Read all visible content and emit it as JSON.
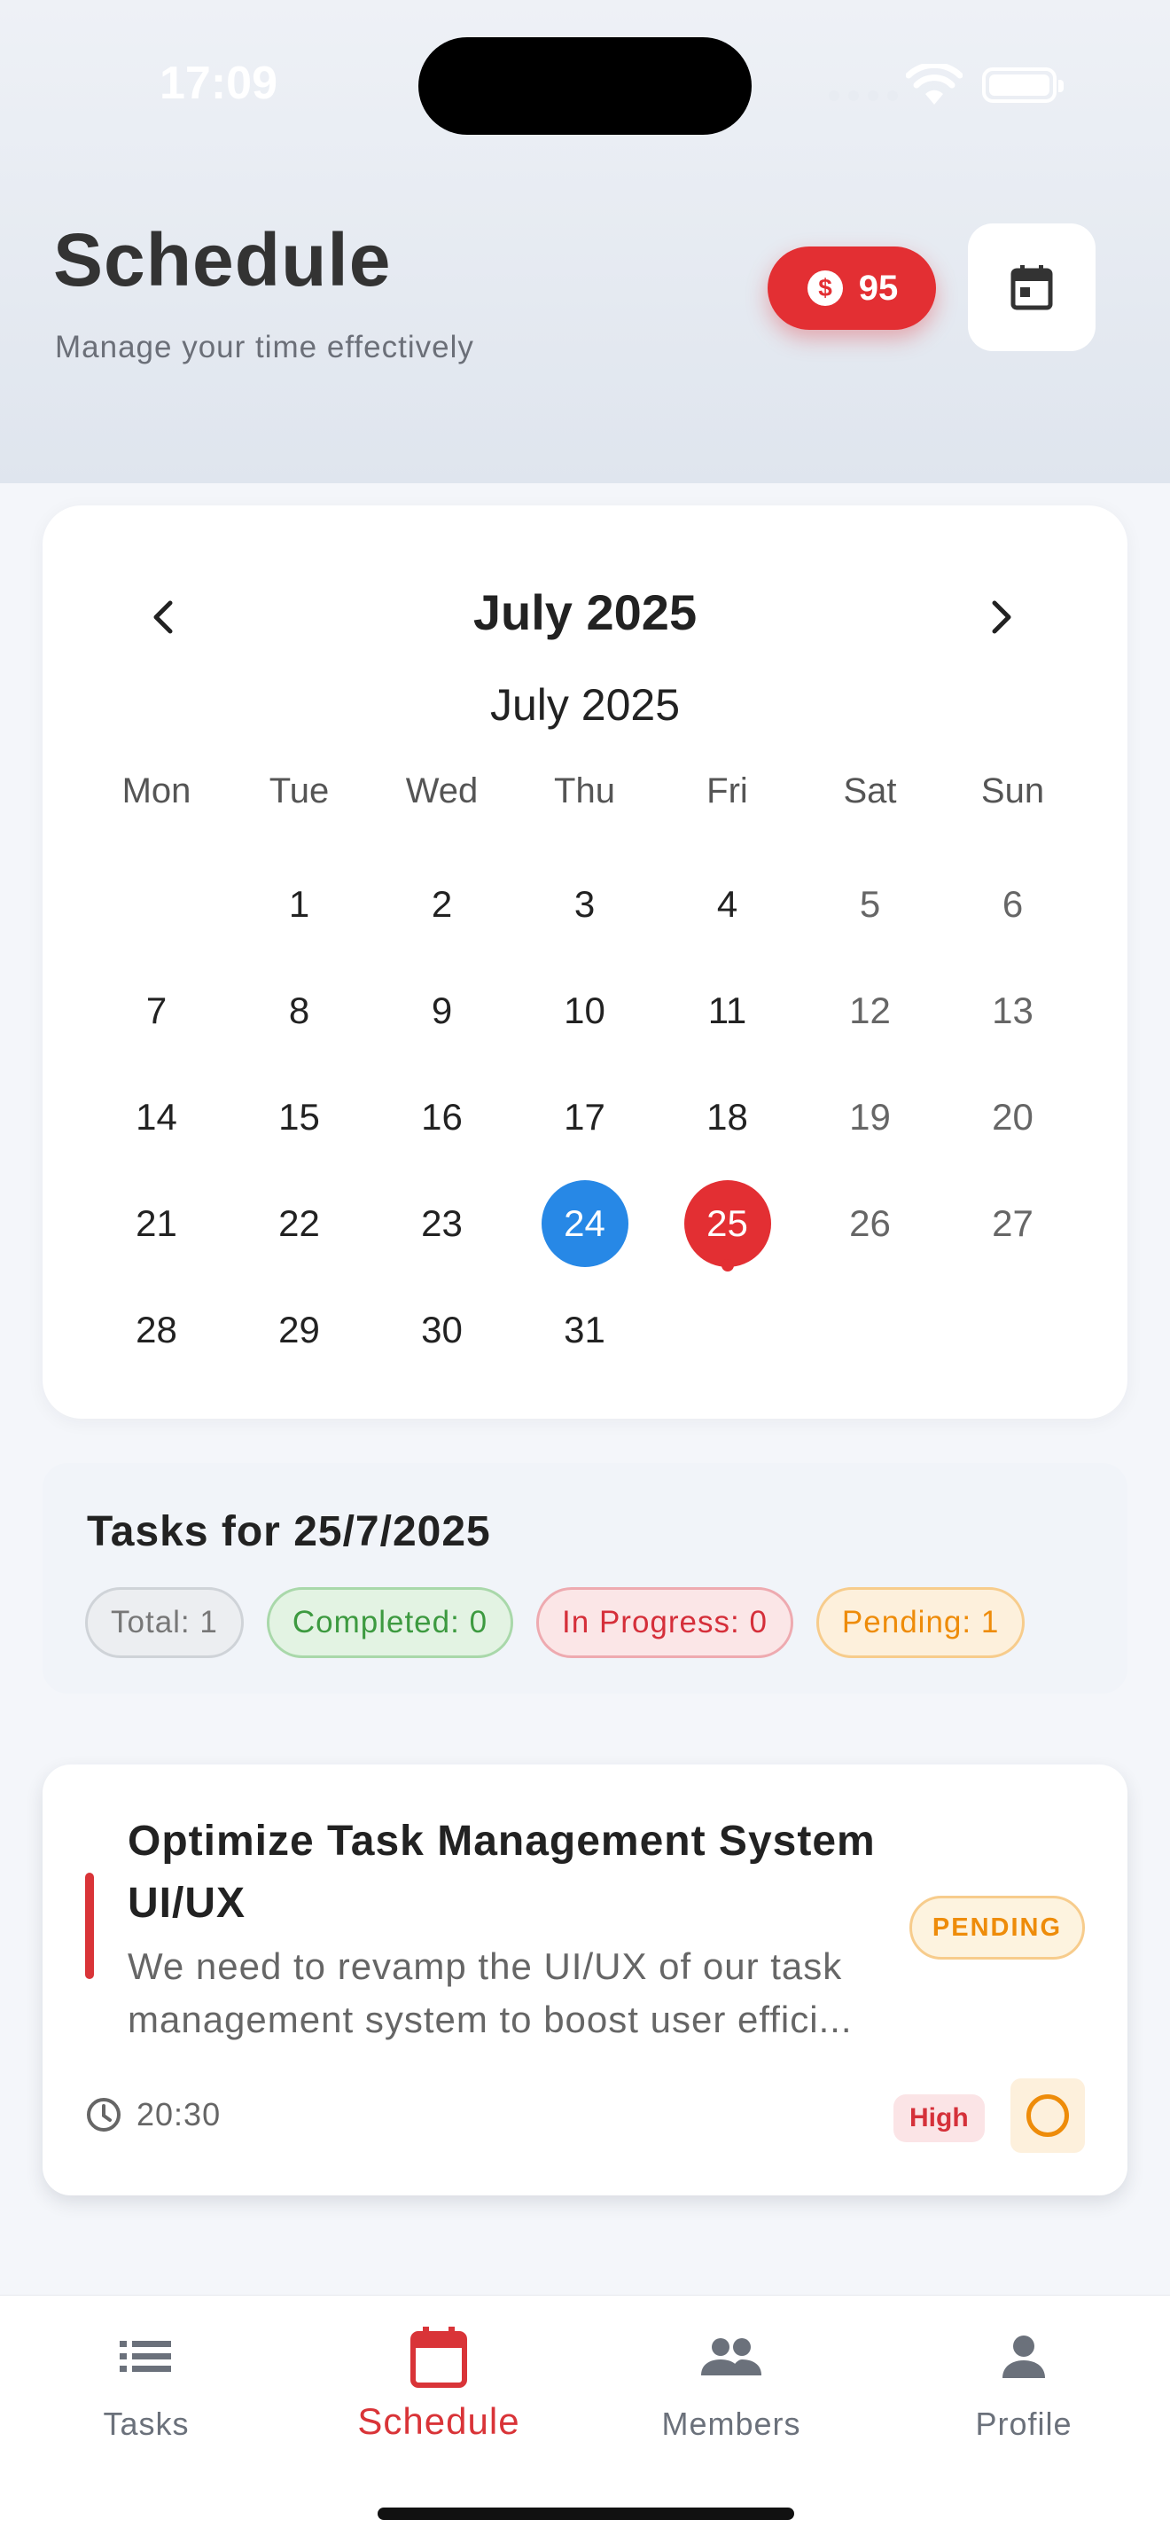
{
  "status_bar": {
    "time": "17:09"
  },
  "header": {
    "title": "Schedule",
    "subtitle": "Manage your time effectively",
    "points": "95",
    "points_icon": "dollar-coin-icon",
    "calendar_icon": "calendar-icon"
  },
  "calendar": {
    "month_title": "July 2025",
    "month_subtitle": "July 2025",
    "weekdays": [
      "Mon",
      "Tue",
      "Wed",
      "Thu",
      "Fri",
      "Sat",
      "Sun"
    ],
    "leading_blanks": 1,
    "days": [
      "1",
      "2",
      "3",
      "4",
      "5",
      "6",
      "7",
      "8",
      "9",
      "10",
      "11",
      "12",
      "13",
      "14",
      "15",
      "16",
      "17",
      "18",
      "19",
      "20",
      "21",
      "22",
      "23",
      "24",
      "25",
      "26",
      "27",
      "28",
      "29",
      "30",
      "31"
    ],
    "today": "24",
    "selected": "25",
    "today_color": "#2788e6",
    "selected_color": "#e32f33"
  },
  "tasks_summary": {
    "heading": "Tasks for 25/7/2025",
    "total": "Total: 1",
    "completed": "Completed: 0",
    "in_progress": "In Progress: 0",
    "pending": "Pending: 1"
  },
  "task": {
    "title": "Optimize Task Management System UI/UX",
    "description": "We need to revamp the UI/UX of our task management system to boost user effici...",
    "status": "PENDING",
    "time": "20:30",
    "priority": "High",
    "priority_color": "#d93438"
  },
  "nav": {
    "tasks": "Tasks",
    "schedule": "Schedule",
    "members": "Members",
    "profile": "Profile",
    "active": "schedule"
  }
}
